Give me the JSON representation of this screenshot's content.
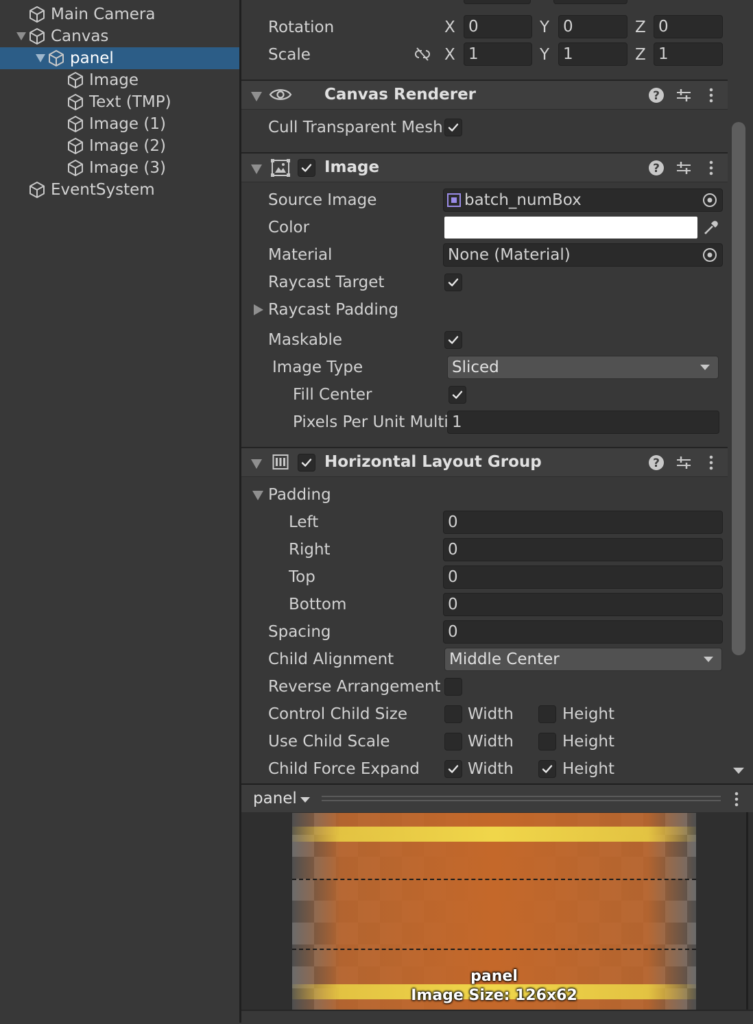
{
  "hierarchy": {
    "items": [
      {
        "label": "Main Camera",
        "depth": 1,
        "foldout": "none",
        "selected": false
      },
      {
        "label": "Canvas",
        "depth": 1,
        "foldout": "expanded",
        "selected": false
      },
      {
        "label": "panel",
        "depth": 2,
        "foldout": "expanded",
        "selected": true
      },
      {
        "label": "Image",
        "depth": 3,
        "foldout": "none",
        "selected": false
      },
      {
        "label": "Text (TMP)",
        "depth": 3,
        "foldout": "none",
        "selected": false
      },
      {
        "label": "Image (1)",
        "depth": 3,
        "foldout": "none",
        "selected": false
      },
      {
        "label": "Image (2)",
        "depth": 3,
        "foldout": "none",
        "selected": false
      },
      {
        "label": "Image (3)",
        "depth": 3,
        "foldout": "none",
        "selected": false
      },
      {
        "label": "EventSystem",
        "depth": 1,
        "foldout": "none",
        "selected": false
      }
    ]
  },
  "transform": {
    "rotation_label": "Rotation",
    "scale_label": "Scale",
    "axis_x": "X",
    "axis_y": "Y",
    "axis_z": "Z",
    "rotation": {
      "x": "0",
      "y": "0",
      "z": "0"
    },
    "scale": {
      "x": "1",
      "y": "1",
      "z": "1"
    }
  },
  "canvas_renderer": {
    "title": "Canvas Renderer",
    "cull_label": "Cull Transparent Mesh",
    "cull_checked": true
  },
  "image": {
    "title": "Image",
    "enabled": true,
    "source_image_label": "Source Image",
    "source_image_value": "batch_numBox",
    "color_label": "Color",
    "color_value": "#ffffff",
    "material_label": "Material",
    "material_value": "None (Material)",
    "raycast_target_label": "Raycast Target",
    "raycast_target_checked": true,
    "raycast_padding_label": "Raycast Padding",
    "maskable_label": "Maskable",
    "maskable_checked": true,
    "image_type_label": "Image Type",
    "image_type_value": "Sliced",
    "fill_center_label": "Fill Center",
    "fill_center_checked": true,
    "ppu_label": "Pixels Per Unit Multi",
    "ppu_value": "1"
  },
  "layout_group": {
    "title": "Horizontal Layout Group",
    "enabled": true,
    "padding_label": "Padding",
    "left_label": "Left",
    "left_value": "0",
    "right_label": "Right",
    "right_value": "0",
    "top_label": "Top",
    "top_value": "0",
    "bottom_label": "Bottom",
    "bottom_value": "0",
    "spacing_label": "Spacing",
    "spacing_value": "0",
    "child_alignment_label": "Child Alignment",
    "child_alignment_value": "Middle Center",
    "reverse_label": "Reverse Arrangement",
    "reverse_checked": false,
    "control_size_label": "Control Child Size",
    "use_scale_label": "Use Child Scale",
    "force_expand_label": "Child Force Expand",
    "width_label": "Width",
    "height_label": "Height",
    "control_size": {
      "width": false,
      "height": false
    },
    "use_scale": {
      "width": false,
      "height": false
    },
    "force_expand": {
      "width": true,
      "height": true
    }
  },
  "preview": {
    "title": "panel",
    "caption_name": "panel",
    "caption_size": "Image Size: 126x62"
  },
  "colors": {
    "accent_selected": "#2c5d87",
    "panel_orange": "#c4682a",
    "stripe_yellow": "#e8cd44"
  }
}
